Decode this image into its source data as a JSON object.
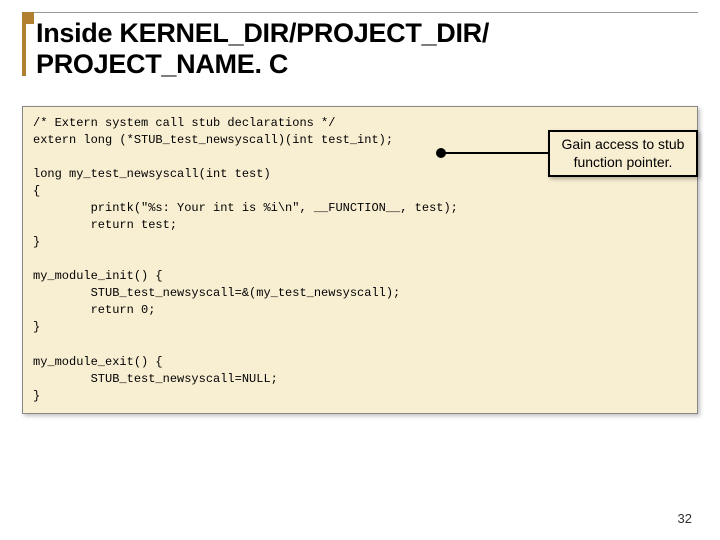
{
  "header": {
    "title_line1": "Inside KERNEL_DIR/PROJECT_DIR/",
    "title_line2": "PROJECT_NAME. C"
  },
  "code": {
    "line1": "/* Extern system call stub declarations */",
    "line2": "extern long (*STUB_test_newsyscall)(int test_int);",
    "line3": "",
    "line4": "long my_test_newsyscall(int test)",
    "line5": "{",
    "line6": "        printk(\"%s: Your int is %i\\n\", __FUNCTION__, test);",
    "line7": "        return test;",
    "line8": "}",
    "line9": "",
    "line10": "my_module_init() {",
    "line11": "        STUB_test_newsyscall=&(my_test_newsyscall);",
    "line12": "        return 0;",
    "line13": "}",
    "line14": "",
    "line15": "my_module_exit() {",
    "line16": "        STUB_test_newsyscall=NULL;",
    "line17": "}"
  },
  "callout": {
    "text": "Gain access to stub function pointer."
  },
  "page_number": "32"
}
